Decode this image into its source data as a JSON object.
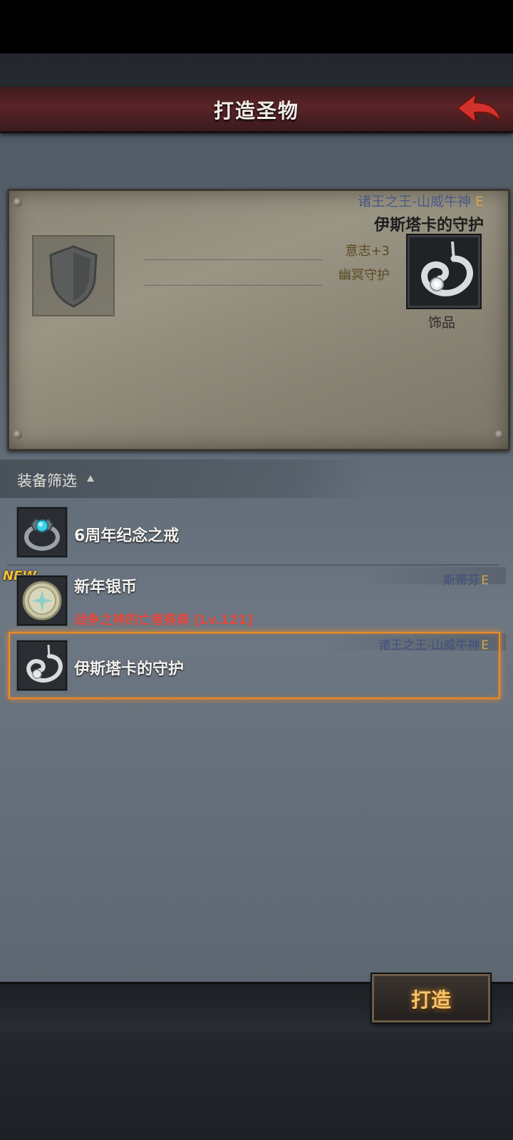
{
  "header": {
    "title": "打造圣物"
  },
  "preview": {
    "owner": "诸王之王-山威牛神",
    "owner_rank": "E",
    "item_name": "伊斯塔卡的守护",
    "stat1": "意志+3",
    "stat2": "幽冥守护",
    "item_type": "饰品"
  },
  "filter": {
    "label": "装备筛选"
  },
  "items": [
    {
      "name": "6周年纪念之戒",
      "icon": "ring-icon"
    },
    {
      "name": "新年银币",
      "badge": "NEW",
      "owner": "斯蒂芬",
      "owner_rank": "E",
      "source": "战争之神的亡者祭典",
      "level": "[Lv.121]",
      "icon": "coin-icon"
    },
    {
      "name": "伊斯塔卡的守护",
      "owner": "诸王之王-山威牛神",
      "owner_rank": "E",
      "icon": "amulet-icon",
      "selected": true
    }
  ],
  "footer": {
    "forge_label": "打造"
  },
  "colors": {
    "accent": "#f08a24",
    "header_red": "#5a2428",
    "rank_gold": "#d9a446",
    "source_red": "#e24a3f"
  }
}
